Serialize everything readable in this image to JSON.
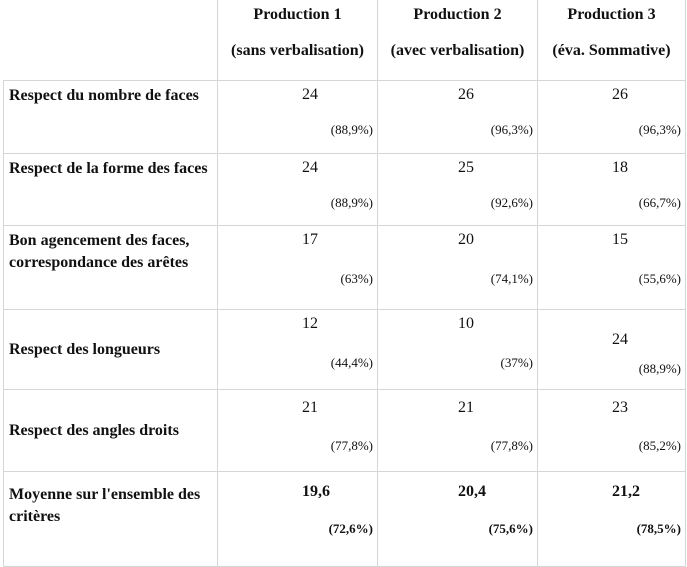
{
  "header": {
    "columns": [
      {
        "title": "Production 1",
        "subtitle": "(sans verbalisation)"
      },
      {
        "title": "Production 2",
        "subtitle": "(avec verbalisation)"
      },
      {
        "title": "Production 3",
        "subtitle": "(éva. Sommative)"
      }
    ]
  },
  "rows": [
    {
      "criterion": "Respect du nombre de faces",
      "values": [
        {
          "count": "24",
          "percent": "(88,9%)"
        },
        {
          "count": "26",
          "percent": "(96,3%)"
        },
        {
          "count": "26",
          "percent": "(96,3%)"
        }
      ]
    },
    {
      "criterion": "Respect de la forme des faces",
      "values": [
        {
          "count": "24",
          "percent": "(88,9%)"
        },
        {
          "count": "25",
          "percent": "(92,6%)"
        },
        {
          "count": "18",
          "percent": "(66,7%)"
        }
      ]
    },
    {
      "criterion": "Bon agencement des faces, correspondance des arêtes",
      "values": [
        {
          "count": "17",
          "percent": "(63%)"
        },
        {
          "count": "20",
          "percent": "(74,1%)"
        },
        {
          "count": "15",
          "percent": "(55,6%)"
        }
      ]
    },
    {
      "criterion": "Respect des longueurs",
      "values": [
        {
          "count": "12",
          "percent": "(44,4%)"
        },
        {
          "count": "10",
          "percent": "(37%)"
        },
        {
          "count": "24",
          "percent": "(88,9%)"
        }
      ]
    },
    {
      "criterion": "Respect des angles droits",
      "values": [
        {
          "count": "21",
          "percent": "(77,8%)"
        },
        {
          "count": "21",
          "percent": "(77,8%)"
        },
        {
          "count": "23",
          "percent": "(85,2%)"
        }
      ]
    },
    {
      "criterion": "Moyenne sur l'ensemble des critères",
      "values": [
        {
          "count": "19,6",
          "percent": "(72,6%)"
        },
        {
          "count": "20,4",
          "percent": "(75,6%)"
        },
        {
          "count": "21,2",
          "percent": "(78,5%)"
        }
      ]
    }
  ]
}
